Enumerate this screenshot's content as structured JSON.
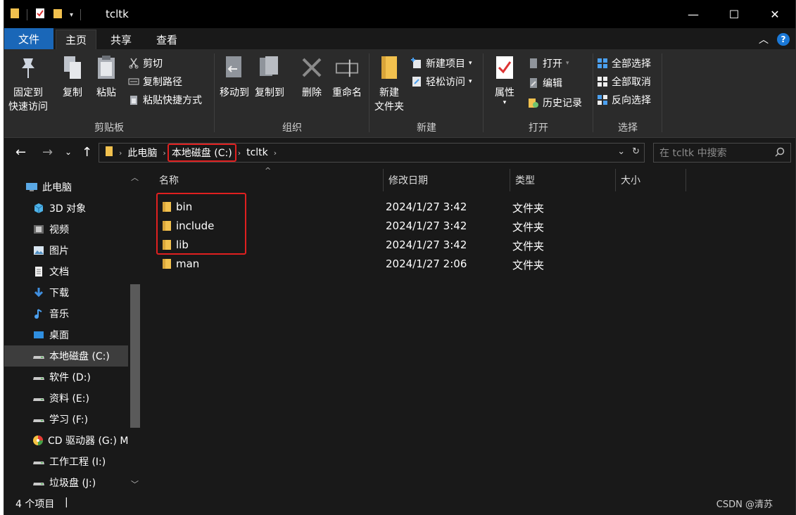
{
  "window": {
    "title": "tcltk",
    "minimize": "—",
    "maximize": "☐",
    "close": "✕"
  },
  "ribbon_tabs": [
    "文件",
    "主页",
    "共享",
    "查看"
  ],
  "help": "?",
  "ribbon": {
    "clipboard": {
      "label": "剪贴板",
      "pin": [
        "固定到",
        "快速访问"
      ],
      "copy": "复制",
      "paste": "粘贴",
      "cut": "剪切",
      "copy_path": "复制路径",
      "paste_shortcut": "粘贴快捷方式"
    },
    "organize": {
      "label": "组织",
      "move_to": "移动到",
      "copy_to": "复制到",
      "delete": "删除",
      "rename": "重命名"
    },
    "new": {
      "label": "新建",
      "new_folder": [
        "新建",
        "文件夹"
      ],
      "new_item": "新建项目",
      "easy_access": "轻松访问"
    },
    "open": {
      "label": "打开",
      "properties": "属性",
      "open": "打开",
      "edit": "编辑",
      "history": "历史记录"
    },
    "select": {
      "label": "选择",
      "select_all": "全部选择",
      "select_none": "全部取消",
      "invert": "反向选择"
    }
  },
  "address": {
    "crumbs": [
      "此电脑",
      "本地磁盘 (C:)",
      "tcltk"
    ],
    "search_placeholder": "在 tcltk 中搜索"
  },
  "nav_pane": [
    {
      "label": "此电脑",
      "icon": "pc-icon"
    },
    {
      "label": "3D 对象",
      "icon": "cube-icon"
    },
    {
      "label": "视频",
      "icon": "video-icon"
    },
    {
      "label": "图片",
      "icon": "picture-icon"
    },
    {
      "label": "文档",
      "icon": "document-icon"
    },
    {
      "label": "下载",
      "icon": "download-icon"
    },
    {
      "label": "音乐",
      "icon": "music-icon"
    },
    {
      "label": "桌面",
      "icon": "desktop-icon"
    },
    {
      "label": "本地磁盘 (C:)",
      "icon": "drive-icon",
      "selected": true
    },
    {
      "label": "软件 (D:)",
      "icon": "drive-icon"
    },
    {
      "label": "资料 (E:)",
      "icon": "drive-icon"
    },
    {
      "label": "学习 (F:)",
      "icon": "drive-icon"
    },
    {
      "label": "CD 驱动器 (G:) M",
      "icon": "cd-drive-icon"
    },
    {
      "label": "工作工程 (I:)",
      "icon": "drive-icon"
    },
    {
      "label": "垃圾盘 (J:)",
      "icon": "drive-icon"
    }
  ],
  "columns": [
    "名称",
    "修改日期",
    "类型",
    "大小"
  ],
  "files": [
    {
      "name": "bin",
      "date": "2024/1/27 3:42",
      "type": "文件夹",
      "size": ""
    },
    {
      "name": "include",
      "date": "2024/1/27 3:42",
      "type": "文件夹",
      "size": ""
    },
    {
      "name": "lib",
      "date": "2024/1/27 3:42",
      "type": "文件夹",
      "size": ""
    },
    {
      "name": "man",
      "date": "2024/1/27 2:06",
      "type": "文件夹",
      "size": ""
    }
  ],
  "status": {
    "count": "4 个项目",
    "divider": "|",
    "watermark": "CSDN @清苏"
  },
  "colors": {
    "accent": "#1a67b8",
    "highlight_box": "#e02020",
    "folder": "#f2c14e"
  }
}
